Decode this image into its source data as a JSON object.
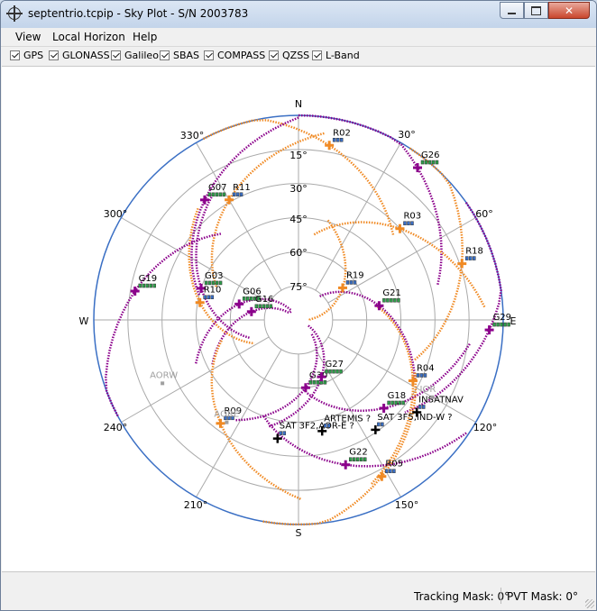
{
  "window": {
    "title": "septentrio.tcpip - Sky Plot - S/N 2003783",
    "icon": "target-icon"
  },
  "menu": [
    "View",
    "Local Horizon",
    "Help"
  ],
  "filters": [
    {
      "label": "GPS",
      "checked": true
    },
    {
      "label": "GLONASS",
      "checked": true
    },
    {
      "label": "Galileo",
      "checked": true
    },
    {
      "label": "SBAS",
      "checked": true
    },
    {
      "label": "COMPASS",
      "checked": true
    },
    {
      "label": "QZSS",
      "checked": true
    },
    {
      "label": "L-Band",
      "checked": true
    }
  ],
  "skyplot": {
    "directions": {
      "north": "N",
      "south": "S",
      "east": "E",
      "west": "W"
    },
    "azimuth_labels": [
      "30°",
      "60°",
      "120°",
      "150°",
      "210°",
      "240°",
      "300°",
      "330°"
    ],
    "elevation_labels": [
      "15°",
      "30°",
      "45°",
      "60°",
      "75°"
    ],
    "colors": {
      "gps": "#8b008b",
      "glonass": "#f08a24",
      "sbas": "#000000",
      "inactive": "#a0a0a0",
      "circle": "#3a6fc4",
      "grid": "#aaaaaa"
    },
    "satellites": [
      {
        "label": "R02",
        "system": "glonass",
        "az": 10,
        "el": 12
      },
      {
        "label": "G26",
        "system": "gps",
        "az": 38,
        "el": 5
      },
      {
        "label": "G07",
        "system": "gps",
        "az": 322,
        "el": 23
      },
      {
        "label": "R11",
        "system": "glonass",
        "az": 330,
        "el": 29
      },
      {
        "label": "R03",
        "system": "glonass",
        "az": 48,
        "el": 30
      },
      {
        "label": "R18",
        "system": "glonass",
        "az": 71,
        "el": 14
      },
      {
        "label": "R19",
        "system": "glonass",
        "az": 54,
        "el": 66
      },
      {
        "label": "G29",
        "system": "gps",
        "az": 93,
        "el": 6
      },
      {
        "label": "G21",
        "system": "gps",
        "az": 80,
        "el": 54
      },
      {
        "label": "G03",
        "system": "gps",
        "az": 288,
        "el": 45
      },
      {
        "label": "R10",
        "system": "glonass",
        "az": 280,
        "el": 46
      },
      {
        "label": "G06",
        "system": "gps",
        "az": 285,
        "el": 63
      },
      {
        "label": "G16",
        "system": "gps",
        "az": 280,
        "el": 69
      },
      {
        "label": "G19",
        "system": "gps",
        "az": 280,
        "el": 17
      },
      {
        "label": "G30",
        "system": "gps",
        "az": 174,
        "el": 60
      },
      {
        "label": "G27",
        "system": "gps",
        "az": 158,
        "el": 63
      },
      {
        "label": "R04",
        "system": "glonass",
        "az": 118,
        "el": 33
      },
      {
        "label": "G18",
        "system": "gps",
        "az": 136,
        "el": 36
      },
      {
        "label": "R09",
        "system": "glonass",
        "az": 217,
        "el": 33
      },
      {
        "label": "G22",
        "system": "gps",
        "az": 162,
        "el": 23
      },
      {
        "label": "R05",
        "system": "glonass",
        "az": 152,
        "el": 12
      }
    ],
    "sbas": [
      {
        "label": "INSATNAV",
        "az": 128,
        "el": 24
      },
      {
        "label": "SAT 3F2,AOR-E ?",
        "az": 190,
        "el": 37
      },
      {
        "label": "ARTEMIS ?",
        "az": 168,
        "el": 40
      },
      {
        "label": "SAT 3F5,IND-W ?",
        "az": 145,
        "el": 31
      }
    ],
    "inactive": [
      {
        "label": "AORW",
        "az": 245,
        "el": 24
      },
      {
        "label": "AORE",
        "az": 215,
        "el": 35
      },
      {
        "label": "IOR",
        "az": 120,
        "el": 22
      }
    ]
  },
  "status": {
    "tracking_mask": "Tracking Mask: 0°",
    "pvt_mask": "PVT Mask: 0°"
  }
}
